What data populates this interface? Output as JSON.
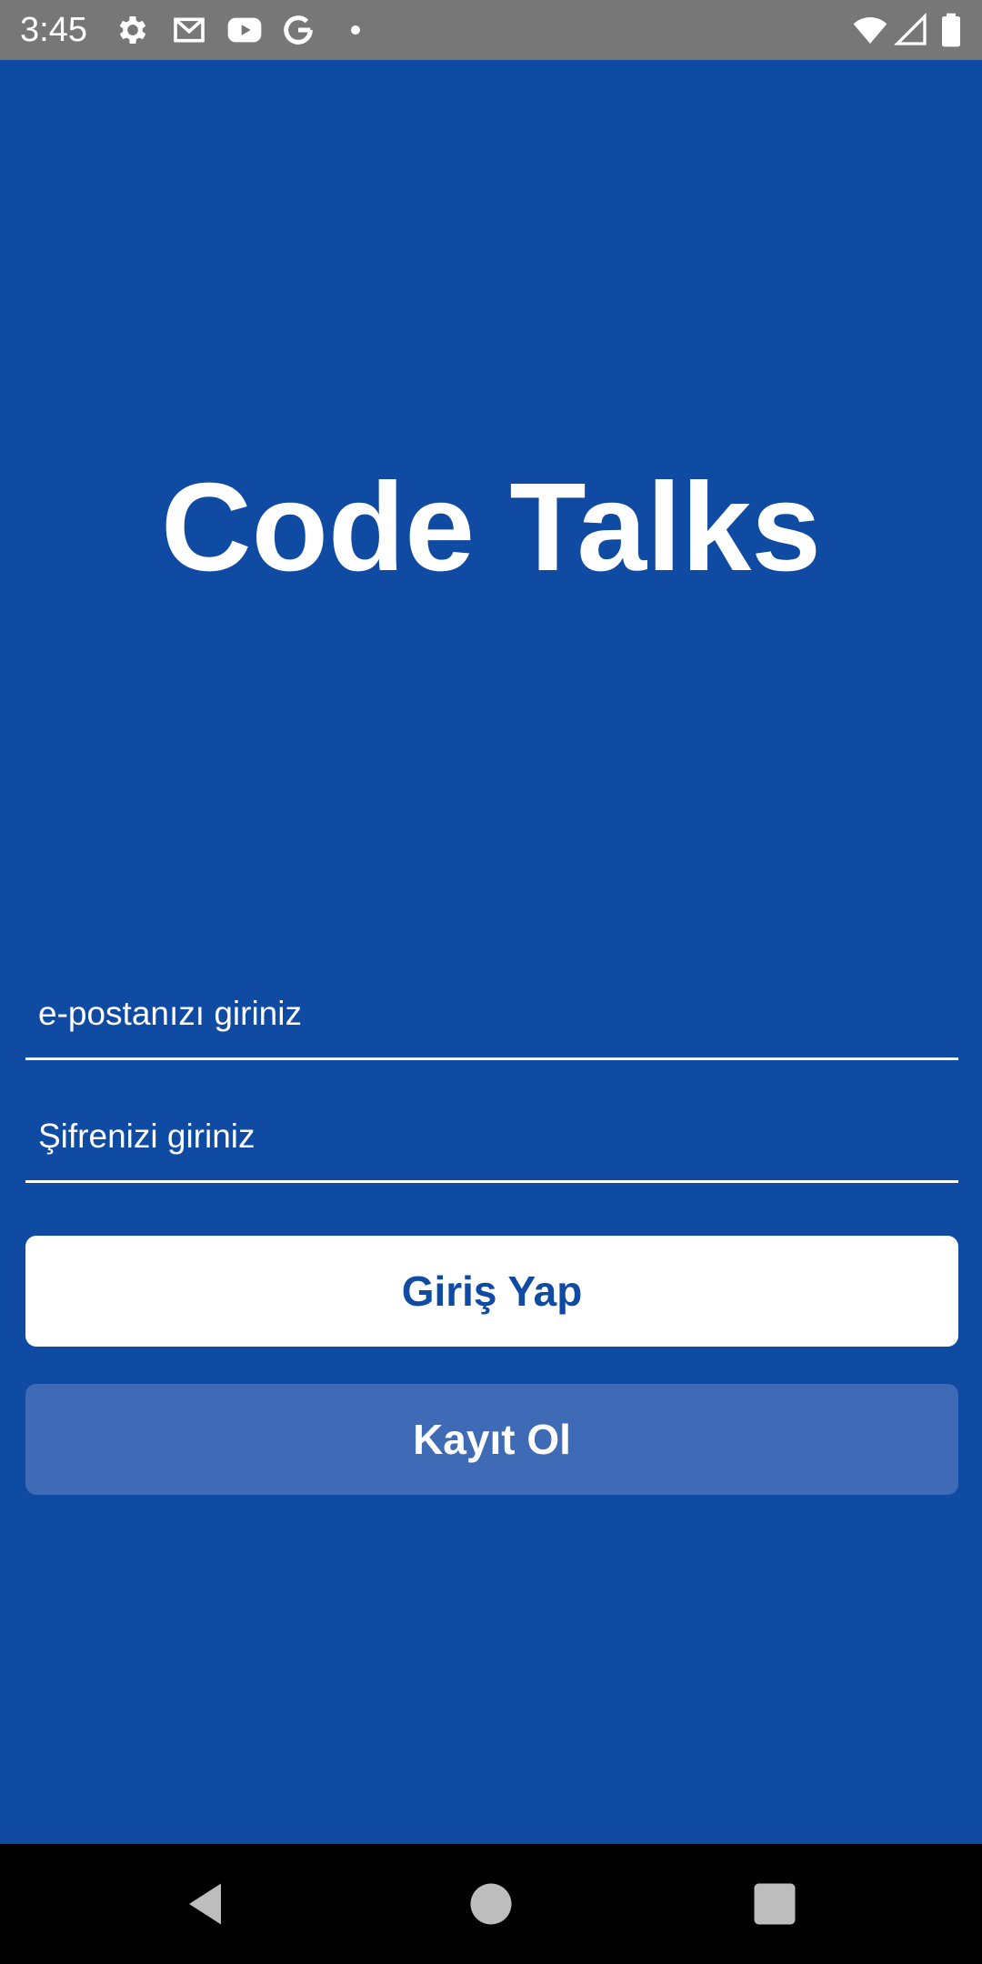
{
  "status_bar": {
    "time": "3:45",
    "left_icons": [
      "settings-icon",
      "gmail-icon",
      "youtube-icon",
      "google-icon",
      "dot-icon"
    ],
    "right_icons": [
      "wifi-icon",
      "signal-icon",
      "battery-icon"
    ]
  },
  "app": {
    "title": "Code Talks"
  },
  "form": {
    "email_placeholder": "e-postanızı giriniz",
    "password_placeholder": "Şifrenizi giriniz",
    "login_label": "Giriş Yap",
    "register_label": "Kayıt Ol"
  },
  "colors": {
    "background": "#0f4aa3",
    "status_bar": "#777777",
    "register_button": "#3f6bb6",
    "login_button": "#ffffff",
    "nav_bar": "#000000"
  },
  "nav_bar": {
    "buttons": [
      "back-icon",
      "home-icon",
      "recents-icon"
    ]
  }
}
